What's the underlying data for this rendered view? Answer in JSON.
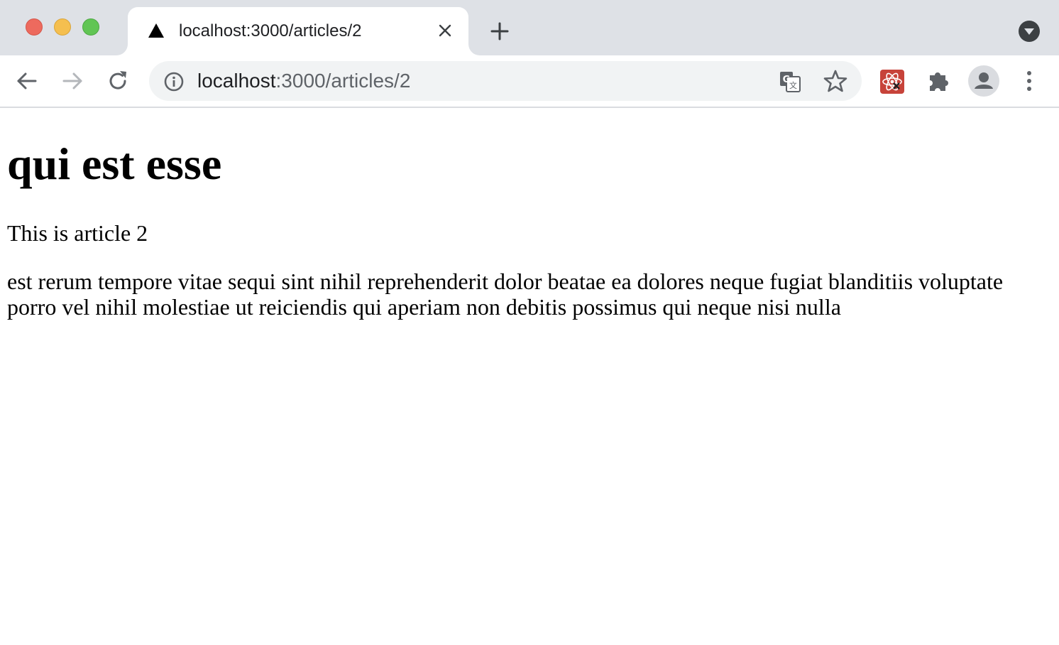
{
  "browser": {
    "tab": {
      "title": "localhost:3000/articles/2"
    },
    "address_bar": {
      "host": "localhost",
      "path": ":3000/articles/2"
    },
    "icons": {
      "favicon": "triangle-icon",
      "tab_close": "close-icon",
      "new_tab": "plus-icon",
      "tab_search": "chevron-down-icon",
      "back": "arrow-left-icon",
      "forward": "arrow-right-icon",
      "reload": "reload-icon",
      "site_info": "info-icon",
      "translate": "translate-icon",
      "bookmark": "star-icon",
      "react_devtools": "react-icon",
      "extensions": "puzzle-icon",
      "profile": "avatar-icon",
      "menu": "kebab-menu-icon"
    },
    "colors": {
      "tabstrip_bg": "#dee1e6",
      "omnibox_bg": "#f1f3f4",
      "traffic_close": "#ed6a5e",
      "traffic_minimize": "#f5bf4f",
      "traffic_maximize": "#61c554",
      "react_ext_bg": "#c7433a"
    }
  },
  "page": {
    "title": "qui est esse",
    "subtitle": "This is article 2",
    "body": "est rerum tempore vitae sequi sint nihil reprehenderit dolor beatae ea dolores neque fugiat blanditiis voluptate porro vel nihil molestiae ut reiciendis qui aperiam non debitis possimus qui neque nisi nulla"
  }
}
